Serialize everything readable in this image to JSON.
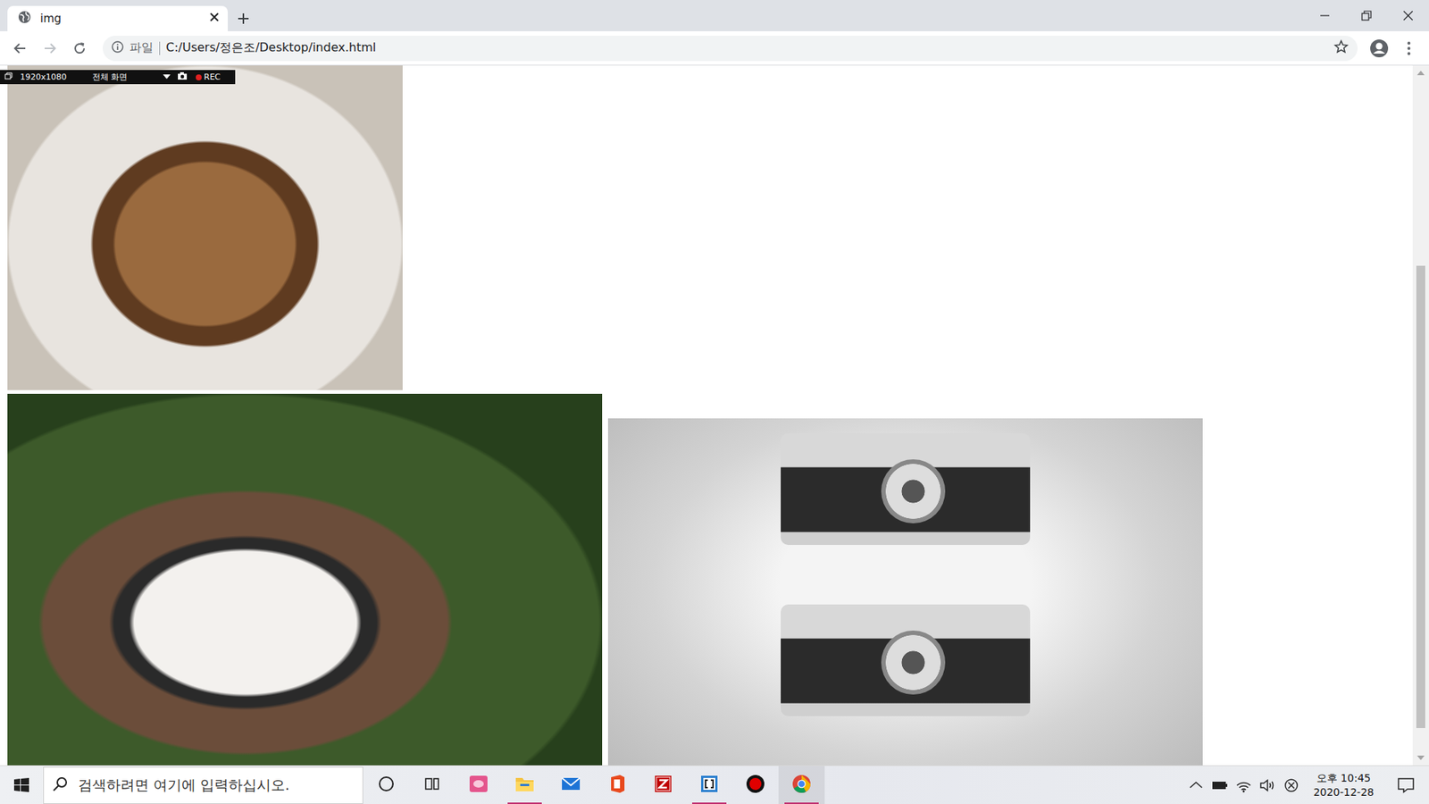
{
  "tabs": [
    {
      "label": "img",
      "selected": true
    }
  ],
  "address_bar": {
    "scheme_label": "파일",
    "url": "C:/Users/정은조/Desktop/index.html",
    "bookmarked": false
  },
  "recorder": {
    "resolution": "1920x1080",
    "mode": "전체 화면",
    "rec": "REC",
    "recording": true
  },
  "scrollbar": {
    "level": 0.69
  },
  "taskbar": {
    "search_placeholder": "검색하려면 여기에 입력하십시오.",
    "apps": [
      {
        "kind": "cortana",
        "running": false,
        "selected": false
      },
      {
        "kind": "taskview",
        "running": false,
        "selected": false
      },
      {
        "kind": "sticky",
        "running": false,
        "selected": false
      },
      {
        "kind": "explorer",
        "running": true,
        "selected": false
      },
      {
        "kind": "mail",
        "running": false,
        "selected": false
      },
      {
        "kind": "office",
        "running": false,
        "selected": false
      },
      {
        "kind": "filezilla",
        "running": false,
        "selected": false
      },
      {
        "kind": "brackets",
        "running": true,
        "selected": false
      },
      {
        "kind": "recorder",
        "running": false,
        "selected": false
      },
      {
        "kind": "chrome",
        "running": true,
        "selected": true
      }
    ],
    "clock": {
      "time": "오후 10:45",
      "date": "2020-12-28"
    }
  }
}
